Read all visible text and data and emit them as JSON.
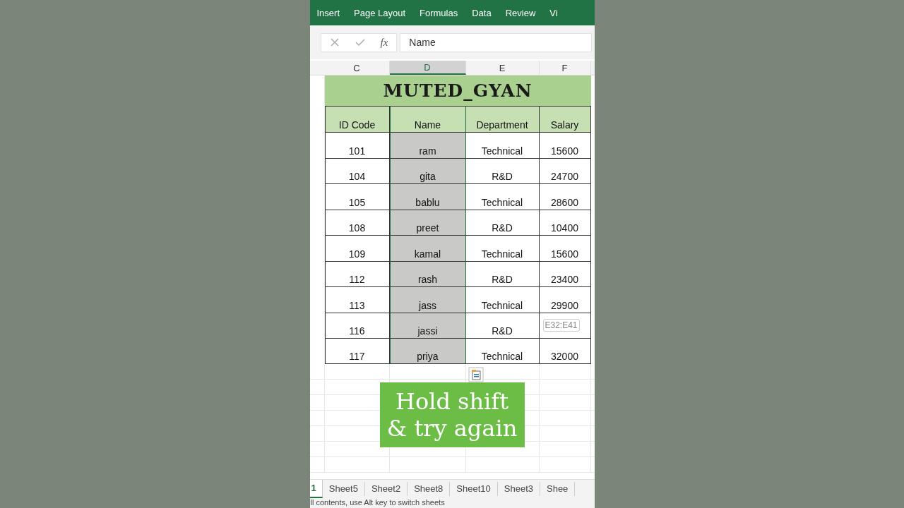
{
  "ribbon_tabs": [
    {
      "label": "Insert"
    },
    {
      "label": "Page Layout"
    },
    {
      "label": "Formulas"
    },
    {
      "label": "Data"
    },
    {
      "label": "Review"
    },
    {
      "label": "Vi"
    }
  ],
  "formula_bar": {
    "function_label": "fx",
    "value": "Name"
  },
  "column_headers": [
    {
      "label": "C",
      "selected": false
    },
    {
      "label": "D",
      "selected": true
    },
    {
      "label": "E",
      "selected": false
    },
    {
      "label": "F",
      "selected": false
    }
  ],
  "title": "MUTED_GYAN",
  "table": {
    "columns": [
      "ID Code",
      "Name",
      "Department",
      "Salary"
    ],
    "rows": [
      {
        "cells": [
          "101",
          "ram",
          "Technical",
          "15600"
        ]
      },
      {
        "cells": [
          "104",
          "gita",
          "R&D",
          "24700"
        ]
      },
      {
        "cells": [
          "105",
          "bablu",
          "Technical",
          "28600"
        ]
      },
      {
        "cells": [
          "108",
          "preet",
          "R&D",
          "10400"
        ]
      },
      {
        "cells": [
          "109",
          "kamal",
          "Technical",
          "15600"
        ]
      },
      {
        "cells": [
          "112",
          "rash",
          "R&D",
          "23400"
        ]
      },
      {
        "cells": [
          "113",
          "jass",
          "Technical",
          "29900"
        ]
      },
      {
        "cells": [
          "116",
          "jassi",
          "R&D"
        ],
        "tooltip": "E32:E41"
      },
      {
        "cells": [
          "117",
          "priya",
          "Technical",
          "32000"
        ]
      }
    ]
  },
  "caption": {
    "lines": [
      "Hold shift",
      "& try again"
    ]
  },
  "sheet_tabs": [
    {
      "label": "1",
      "selected": true
    },
    {
      "label": "Sheet5",
      "selected": false
    },
    {
      "label": "Sheet2",
      "selected": false
    },
    {
      "label": "Sheet8",
      "selected": false
    },
    {
      "label": "Sheet10",
      "selected": false
    },
    {
      "label": "Sheet3",
      "selected": false
    },
    {
      "label": "Shee",
      "selected": false
    }
  ],
  "status_bar": "ll contents, use Alt key to switch sheets"
}
